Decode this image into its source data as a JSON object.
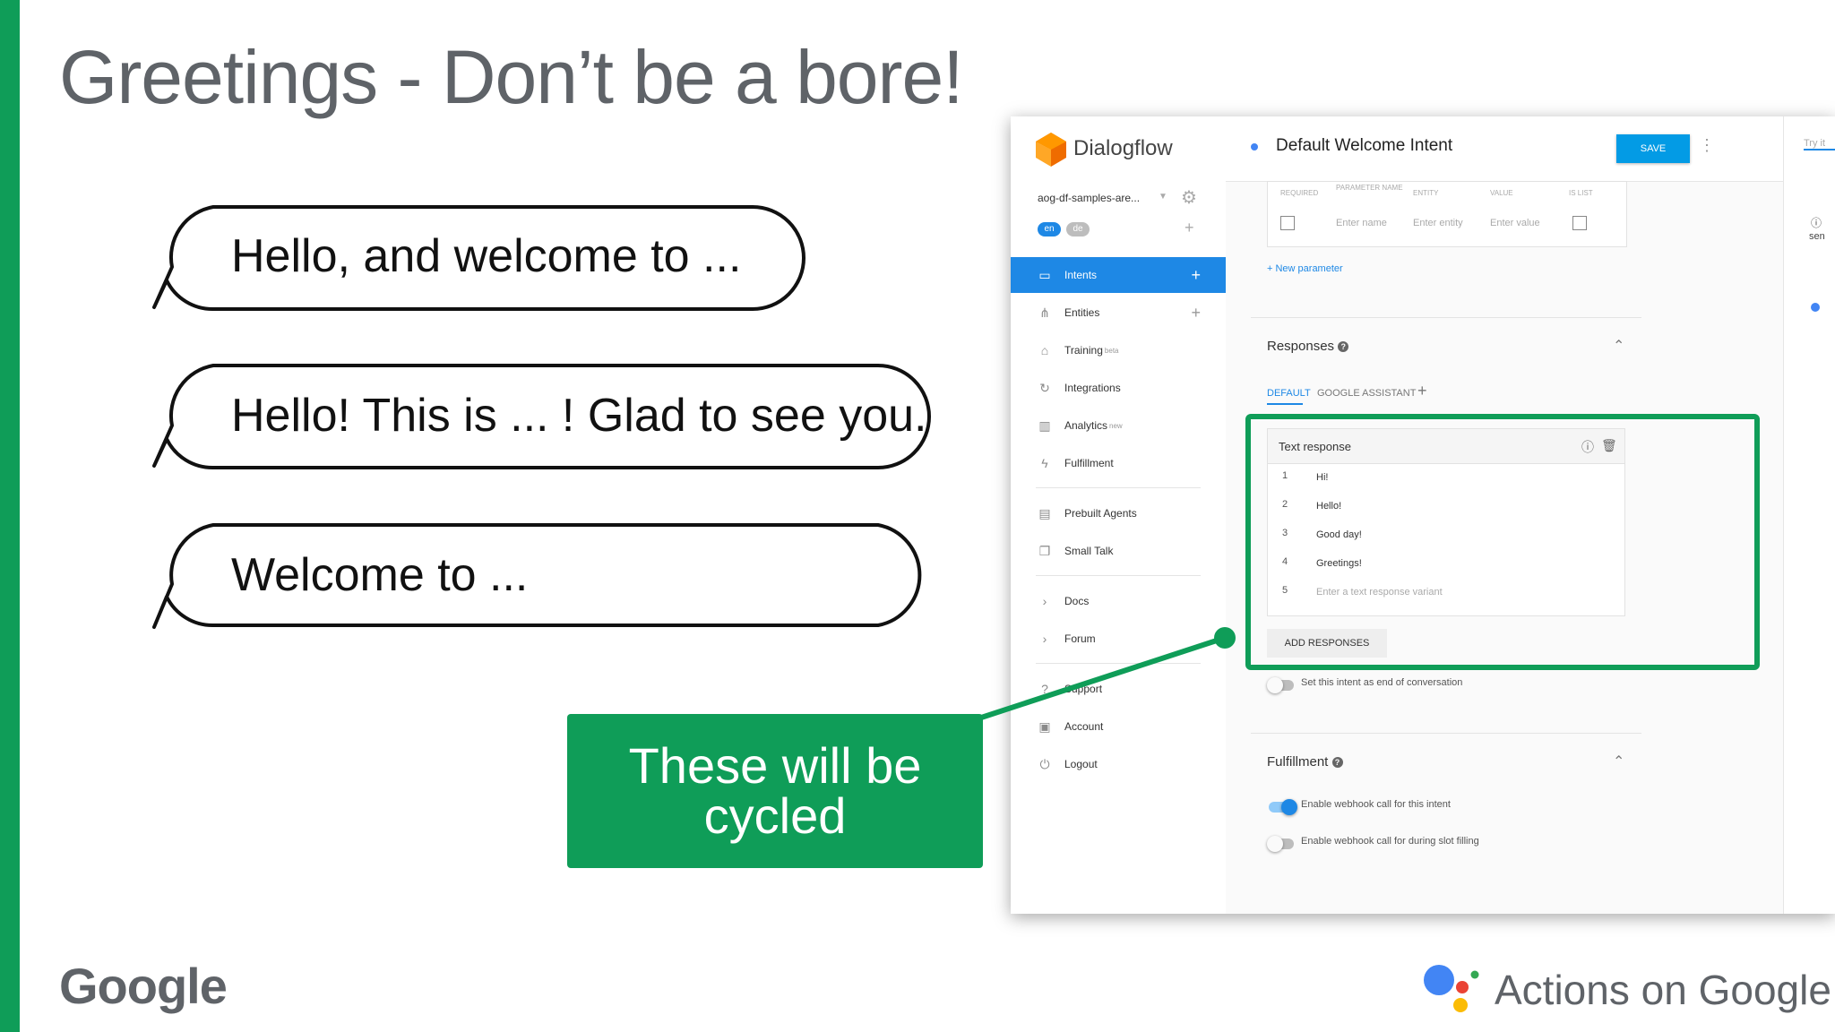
{
  "slide": {
    "title": "Greetings - Don’t be a bore!",
    "bubbles": [
      "Hello, and welcome to ...",
      "Hello! This is ... ! Glad to see you.",
      "Welcome to ..."
    ],
    "callout": "These will be cycled",
    "footer_left": "Google",
    "footer_right": "Actions on Google",
    "accent_color": "#0f9d58"
  },
  "dialogflow": {
    "brand": "Dialogflow",
    "agent": "aog-df-samples-are...",
    "languages": [
      "en",
      "de"
    ],
    "nav": [
      {
        "label": "Intents",
        "icon": "chat-icon"
      },
      {
        "label": "Entities",
        "icon": "hierarchy-icon"
      },
      {
        "label": "Training",
        "badge": "beta",
        "icon": "graduation-cap-icon"
      },
      {
        "label": "Integrations",
        "icon": "sync-icon"
      },
      {
        "label": "Analytics",
        "badge": "new",
        "icon": "bar-chart-icon"
      },
      {
        "label": "Fulfillment",
        "icon": "lightning-icon"
      },
      {
        "label": "Prebuilt Agents",
        "icon": "book-icon"
      },
      {
        "label": "Small Talk",
        "icon": "speech-icon"
      },
      {
        "label": "Docs",
        "icon": "chevron-right-icon"
      },
      {
        "label": "Forum",
        "icon": "chevron-right-icon"
      },
      {
        "label": "Support",
        "icon": "help-icon"
      },
      {
        "label": "Account",
        "icon": "account-icon"
      },
      {
        "label": "Logout",
        "icon": "power-icon"
      }
    ],
    "intent_name": "Default Welcome Intent",
    "save_label": "SAVE",
    "try_placeholder": "Try it",
    "params": {
      "headers": [
        "REQUIRED",
        "PARAMETER NAME",
        "ENTITY",
        "VALUE",
        "IS LIST"
      ],
      "placeholders": [
        "Enter name",
        "Enter entity",
        "Enter value"
      ],
      "new_parameter": "New parameter"
    },
    "responses": {
      "heading": "Responses",
      "tabs": [
        "DEFAULT",
        "GOOGLE ASSISTANT"
      ],
      "card_title": "Text response",
      "items": [
        {
          "n": "1",
          "text": "Hi!"
        },
        {
          "n": "2",
          "text": "Hello!"
        },
        {
          "n": "3",
          "text": "Good day!"
        },
        {
          "n": "4",
          "text": "Greetings!"
        }
      ],
      "new_n": "5",
      "new_placeholder": "Enter a text response variant",
      "add_label": "ADD RESPONSES",
      "end_convo_label": "Set this intent as end of conversation"
    },
    "fulfillment": {
      "heading": "Fulfillment",
      "webhook_label": "Enable webhook call for this intent",
      "webhook_on": true,
      "slot_label": "Enable webhook call for during slot filling",
      "slot_on": false
    },
    "right_snippet": "sen"
  }
}
